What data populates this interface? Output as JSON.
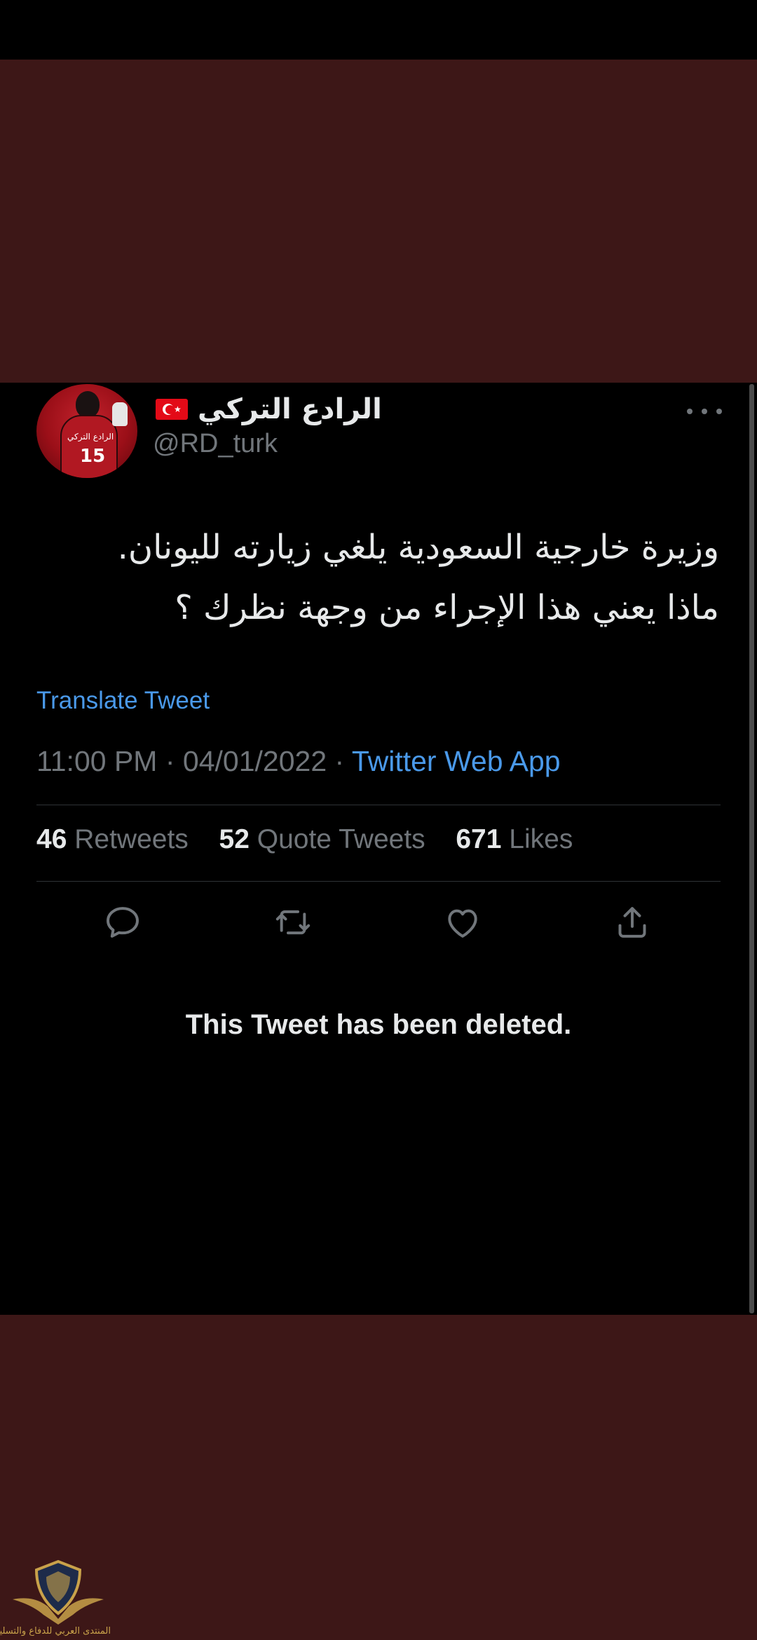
{
  "tweet": {
    "author": {
      "display_name": "الرادع التركي",
      "flag": "turkey-flag",
      "handle": "@RD_turk",
      "avatar": {
        "number": "15",
        "jersey_text": "الرادع التركي"
      }
    },
    "text_lines": [
      "وزيرة خارجية السعودية يلغي زيارته لليونان.",
      "ماذا يعني هذا الإجراء من وجهة نظرك ؟"
    ],
    "translate_label": "Translate Tweet",
    "time": "11:00 PM",
    "date": "04/01/2022",
    "separator": "·",
    "source": "Twitter Web App",
    "stats": {
      "retweets_count": "46",
      "retweets_label": "Retweets",
      "quotes_count": "52",
      "quotes_label": "Quote Tweets",
      "likes_count": "671",
      "likes_label": "Likes"
    },
    "actions": [
      "reply-icon",
      "retweet-icon",
      "like-icon",
      "share-icon"
    ],
    "deleted_notice": "This Tweet has been deleted."
  },
  "watermark": {
    "text": "المنتدى العربي للدفاع والتسليح"
  },
  "colors": {
    "background_frame": "#3d1717",
    "card": "#000000",
    "text_primary": "#e7e9ea",
    "text_secondary": "#71767b",
    "link": "#4a99e9"
  }
}
